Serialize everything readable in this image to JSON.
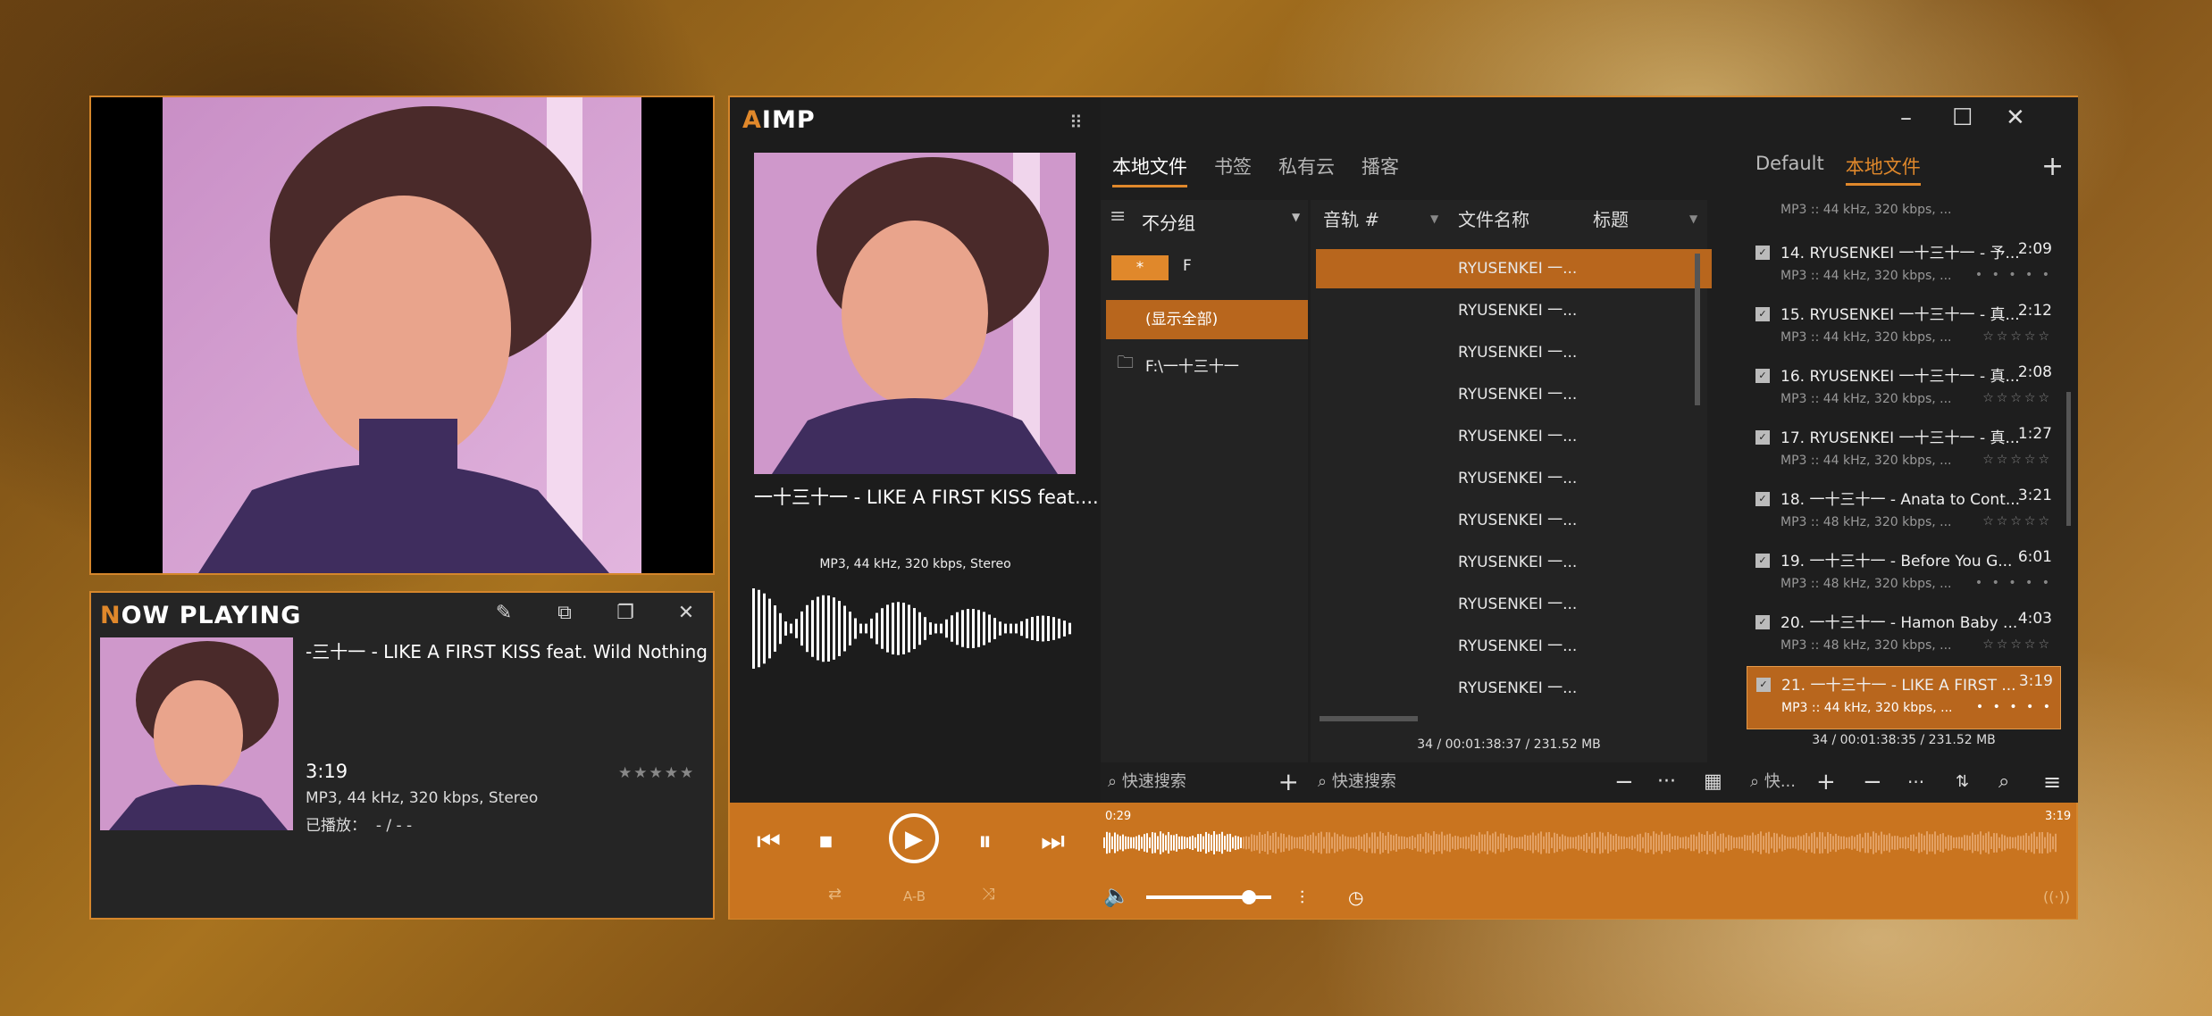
{
  "cover_window": {},
  "now_playing": {
    "title_first": "N",
    "title_rest": "OW PLAYING",
    "track": "-三十一 - LIKE A FIRST KISS feat. Wild Nothing",
    "time": "3:19",
    "format": "MP3, 44 kHz, 320 kbps, Stereo",
    "played_label": "已播放：",
    "played_value": "- / - -",
    "icons": [
      "pencil-icon",
      "copy-icon",
      "duplicate-icon",
      "close-icon"
    ]
  },
  "main": {
    "logo_mark": "A",
    "logo_text": "IMP",
    "now_title": "一十三十一 - LIKE A FIRST KISS feat....",
    "format_line": "MP3, 44 kHz, 320 kbps, Stereo",
    "tabs": [
      "本地文件",
      "书签",
      "私有云",
      "播客"
    ],
    "group": {
      "label": "不分组",
      "filter_star": "*",
      "filter_letter": "F",
      "show_all": "(显示全部)",
      "folder": "F:\\一十三十一"
    },
    "columns": [
      "音轨 #",
      "文件名称",
      "标题"
    ],
    "tracks": [
      "RYUSENKEI 一...",
      "RYUSENKEI 一...",
      "RYUSENKEI 一...",
      "RYUSENKEI 一...",
      "RYUSENKEI 一...",
      "RYUSENKEI 一...",
      "RYUSENKEI 一...",
      "RYUSENKEI 一...",
      "RYUSENKEI 一...",
      "RYUSENKEI 一...",
      "RYUSENKEI 一..."
    ],
    "status": "34 / 00:01:38:37 / 231.52 MB",
    "search_placeholder": "快速搜索",
    "search_placeholder2": "快速搜索"
  },
  "playlist": {
    "tabs": [
      "Default",
      "本地文件"
    ],
    "add": "+",
    "top_partial_info": "MP3 :: 44 kHz, 320 kbps, ...",
    "items": [
      {
        "name": "14. RYUSENKEI 一十三十一 - 予...",
        "dur": "2:09",
        "info": "MP3 :: 44 kHz, 320 kbps, ...",
        "stars": "• • • • •"
      },
      {
        "name": "15. RYUSENKEI 一十三十一 - 真...",
        "dur": "2:12",
        "info": "MP3 :: 44 kHz, 320 kbps, ...",
        "stars": "☆☆☆☆☆"
      },
      {
        "name": "16. RYUSENKEI 一十三十一 - 真...",
        "dur": "2:08",
        "info": "MP3 :: 44 kHz, 320 kbps, ...",
        "stars": "☆☆☆☆☆"
      },
      {
        "name": "17. RYUSENKEI 一十三十一 - 真...",
        "dur": "1:27",
        "info": "MP3 :: 44 kHz, 320 kbps, ...",
        "stars": "☆☆☆☆☆"
      },
      {
        "name": "18. 一十三十一 - Anata to Cont...",
        "dur": "3:21",
        "info": "MP3 :: 48 kHz, 320 kbps, ...",
        "stars": "☆☆☆☆☆"
      },
      {
        "name": "19. 一十三十一 - Before You G...",
        "dur": "6:01",
        "info": "MP3 :: 48 kHz, 320 kbps, ...",
        "stars": "• • • • •"
      },
      {
        "name": "20. 一十三十一 - Hamon Baby ...",
        "dur": "4:03",
        "info": "MP3 :: 48 kHz, 320 kbps, ...",
        "stars": "☆☆☆☆☆"
      },
      {
        "name": "21. 一十三十一 - LIKE A FIRST ...",
        "dur": "3:19",
        "info": "MP3 :: 44 kHz, 320 kbps, ...",
        "stars": "• • • • •"
      }
    ],
    "status": "34 / 00:01:38:35 / 231.52 MB",
    "search_placeholder": "快..."
  },
  "player": {
    "elapsed": "0:29",
    "total": "3:19",
    "progress": 0.146,
    "volume": 0.82,
    "ab_label": "A-B"
  }
}
